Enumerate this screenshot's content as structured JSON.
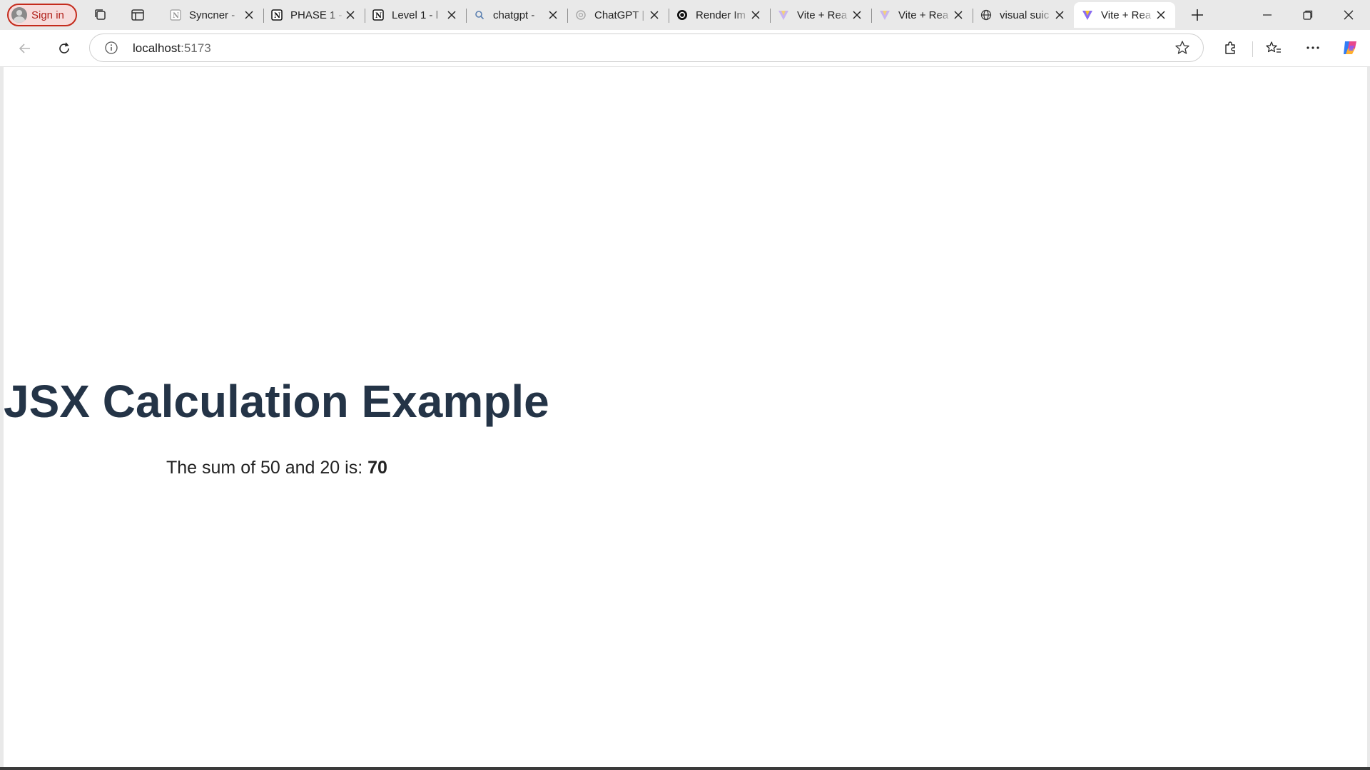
{
  "browser": {
    "signin_label": "Sign in",
    "tabs": [
      {
        "title": "Syncner -",
        "icon": "notion-icon"
      },
      {
        "title": "PHASE 1 -",
        "icon": "notion-icon"
      },
      {
        "title": "Level 1 - l",
        "icon": "notion-icon"
      },
      {
        "title": "chatgpt -",
        "icon": "search-icon"
      },
      {
        "title": "ChatGPT |",
        "icon": "openai-icon"
      },
      {
        "title": "Render Im",
        "icon": "openai-icon"
      },
      {
        "title": "Vite + Rea",
        "icon": "vite-icon"
      },
      {
        "title": "Vite + Rea",
        "icon": "vite-icon"
      },
      {
        "title": "visual suic",
        "icon": "globe-icon"
      },
      {
        "title": "Vite + Rea",
        "icon": "vite-icon",
        "active": true
      }
    ],
    "address": {
      "host": "localhost",
      "port": ":5173"
    }
  },
  "page": {
    "title": "JSX Calculation Example",
    "result_prefix": "The sum of 50 and 20 is: ",
    "result_value": "70"
  },
  "colors": {
    "title": "#243447",
    "signin_border": "#c42b1c",
    "tabstrip_bg": "#e9e9e9"
  }
}
